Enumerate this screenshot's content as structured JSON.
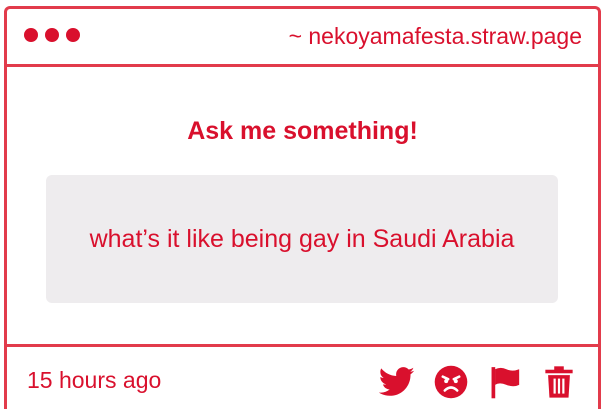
{
  "window": {
    "dots": [
      "red-dot",
      "red-dot",
      "red-dot"
    ],
    "site_label": "~ nekoyamafesta.straw.page"
  },
  "main": {
    "heading": "Ask me something!",
    "question": "what’s it like being gay in Saudi Arabia"
  },
  "footer": {
    "timestamp": "15 hours ago",
    "actions": [
      "twitter-icon",
      "angry-face-icon",
      "flag-icon",
      "trash-icon"
    ]
  },
  "colors": {
    "accent": "#d9102d",
    "border": "#e23b4b",
    "question_bg": "#eeecee"
  }
}
